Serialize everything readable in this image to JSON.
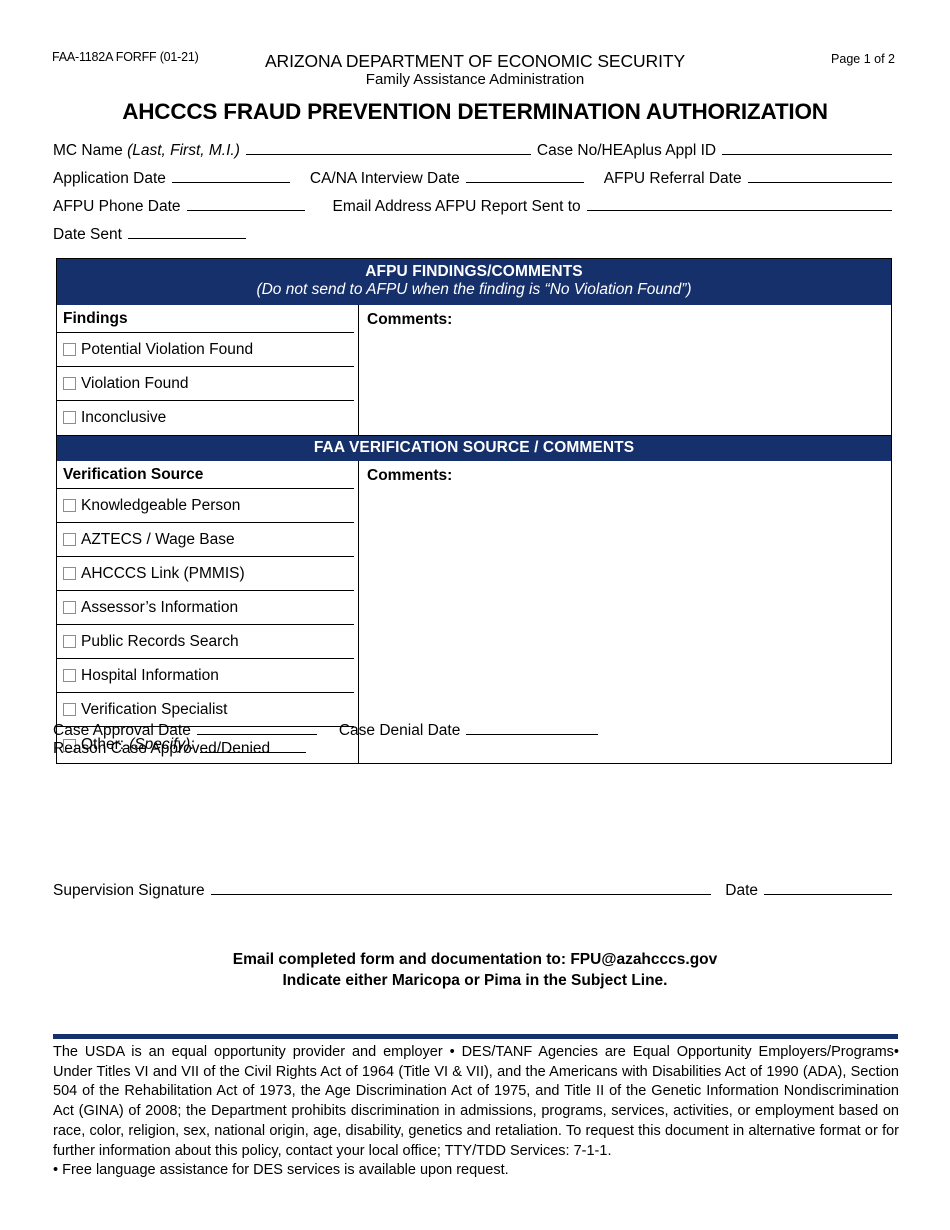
{
  "header": {
    "form_code": "FAA-1182A FORFF (01-21)",
    "page_number": "Page 1 of 2",
    "agency": "ARIZONA DEPARTMENT OF ECONOMIC SECURITY",
    "division": "Family Assistance Administration",
    "doc_title": "AHCCCS FRAUD PREVENTION DETERMINATION AUTHORIZATION"
  },
  "identity": {
    "mc_name_label": "MC Name",
    "mc_name_hint": "(Last, First, M.I.)",
    "case_no_label": "Case No/HEAplus Appl ID",
    "application_date_label": "Application Date",
    "cana_interview_date_label": "CA/NA Interview Date",
    "afpu_referral_date_label": "AFPU Referral Date",
    "afpu_phone_date_label": "AFPU Phone Date",
    "email_report_label": "Email Address AFPU Report Sent to",
    "date_sent_label": "Date Sent",
    "mc_name_value": "",
    "case_no_value": "",
    "application_date_value": "",
    "cana_interview_date_value": "",
    "afpu_referral_date_value": "",
    "afpu_phone_date_value": "",
    "email_report_value": "",
    "date_sent_value": ""
  },
  "afpu_section": {
    "band_title": "AFPU FINDINGS/COMMENTS",
    "band_subtitle": "(Do not send to AFPU when the finding is “No Violation Found”)",
    "column_header": "Findings",
    "comments_label": "Comments:",
    "comments_value": "",
    "options": [
      {
        "label": "Potential Violation Found",
        "checked": false
      },
      {
        "label": "Violation Found",
        "checked": false
      },
      {
        "label": "Inconclusive",
        "checked": false
      }
    ]
  },
  "faa_section": {
    "band_title": "FAA VERIFICATION SOURCE / COMMENTS",
    "column_header": "Verification Source",
    "comments_label": "Comments:",
    "comments_value": "",
    "options": [
      {
        "label": "Knowledgeable Person",
        "checked": false
      },
      {
        "label": "AZTECS / Wage Base",
        "checked": false
      },
      {
        "label": "AHCCCS Link (PMMIS)",
        "checked": false
      },
      {
        "label": "Assessor’s Information",
        "checked": false
      },
      {
        "label": "Public Records Search",
        "checked": false
      },
      {
        "label": "Hospital Information",
        "checked": false
      },
      {
        "label": "Verification Specialist",
        "checked": false
      }
    ],
    "other_label": "Other:",
    "other_hint": "(Specify):",
    "other_value": "",
    "other_checked": false
  },
  "approval": {
    "case_approval_date_label": "Case Approval Date",
    "case_approval_date_value": "",
    "case_denial_date_label": "Case Denial Date",
    "case_denial_date_value": "",
    "reason_label": "Reason Case Approved/Denied",
    "reason_value": ""
  },
  "signature": {
    "supervision_label": "Supervision Signature",
    "supervision_value": "",
    "date_label": "Date",
    "date_value": ""
  },
  "submission": {
    "line1": "Email completed form and documentation to: FPU@azahcccs.gov",
    "line2": "Indicate either Maricopa or Pima in the Subject Line."
  },
  "footer": {
    "body": "The USDA is an equal opportunity provider and employer • DES/TANF Agencies are Equal Opportunity Employers/Programs• Under Titles VI and VII of the Civil Rights Act of 1964 (Title VI & VII), and the Americans with Disabilities Act of 1990 (ADA), Section 504 of the Rehabilitation Act of 1973, the Age Discrimination Act of 1975, and Title II of the Genetic Information Nondiscrimination Act (GINA) of 2008; the Department prohibits discrimination in admissions, programs, services, activities, or employment based on race, color, religion, sex, national origin, age, disability, genetics and retaliation. To request this document in alternative format or for further information about this policy, contact your local office; TTY/TDD Services: 7-1-1.",
    "last_line": "• Free language assistance for DES services is available upon request."
  },
  "colors": {
    "band_navy": "#15306b",
    "checkbox_border": "#7f8db3",
    "text": "#000000",
    "page_background": "#ffffff"
  }
}
